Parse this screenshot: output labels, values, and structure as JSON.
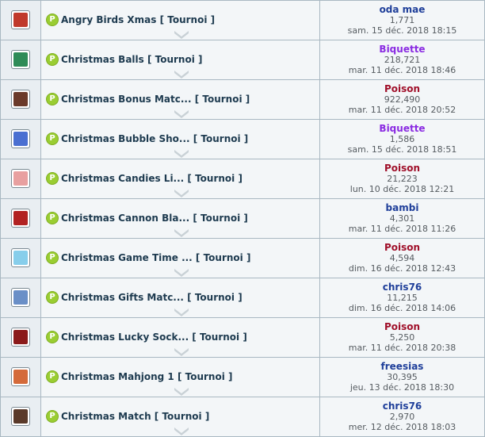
{
  "rows": [
    {
      "title": "Angry Birds Xmas [ Tournoi ]",
      "user": "oda mae",
      "user_color": "#1f3f9a",
      "score": "1,771",
      "date": "sam. 15 déc. 2018 18:15",
      "icon": "angry-birds-thumb-icon",
      "thumb_color": "#c0392b"
    },
    {
      "title": "Christmas Balls [ Tournoi ]",
      "user": "Biquette",
      "user_color": "#8a2be2",
      "score": "218,721",
      "date": "mar. 11 déc. 2018 18:46",
      "icon": "christmas-balls-thumb-icon",
      "thumb_color": "#2e8b57"
    },
    {
      "title": "Christmas Bonus Matc... [ Tournoi ]",
      "user": "Poison",
      "user_color": "#a0102a",
      "score": "922,490",
      "date": "mar. 11 déc. 2018 20:52",
      "icon": "bonus-match-thumb-icon",
      "thumb_color": "#6b3a2a"
    },
    {
      "title": "Christmas Bubble Sho... [ Tournoi ]",
      "user": "Biquette",
      "user_color": "#8a2be2",
      "score": "1,586",
      "date": "sam. 15 déc. 2018 18:51",
      "icon": "bubble-shooter-thumb-icon",
      "thumb_color": "#4a6fd1"
    },
    {
      "title": "Christmas Candies Li... [ Tournoi ]",
      "user": "Poison",
      "user_color": "#a0102a",
      "score": "21,223",
      "date": "lun. 10 déc. 2018 12:21",
      "icon": "candies-thumb-icon",
      "thumb_color": "#e8a0a0"
    },
    {
      "title": "Christmas Cannon Bla... [ Tournoi ]",
      "user": "bambi",
      "user_color": "#1f3f9a",
      "score": "4,301",
      "date": "mar. 11 déc. 2018 11:26",
      "icon": "cannon-thumb-icon",
      "thumb_color": "#b22222"
    },
    {
      "title": "Christmas Game Time ... [ Tournoi ]",
      "user": "Poison",
      "user_color": "#a0102a",
      "score": "4,594",
      "date": "dim. 16 déc. 2018 12:43",
      "icon": "game-time-thumb-icon",
      "thumb_color": "#87ceeb"
    },
    {
      "title": "Christmas Gifts Matc... [ Tournoi ]",
      "user": "chris76",
      "user_color": "#1f3f9a",
      "score": "11,215",
      "date": "dim. 16 déc. 2018 14:06",
      "icon": "gifts-match-thumb-icon",
      "thumb_color": "#6a8fc7"
    },
    {
      "title": "Christmas Lucky Sock... [ Tournoi ]",
      "user": "Poison",
      "user_color": "#a0102a",
      "score": "5,250",
      "date": "mar. 11 déc. 2018 20:38",
      "icon": "lucky-socks-thumb-icon",
      "thumb_color": "#8b1a1a"
    },
    {
      "title": "Christmas Mahjong 1 [ Tournoi ]",
      "user": "freesias",
      "user_color": "#1f3f9a",
      "score": "30,395",
      "date": "jeu. 13 déc. 2018 18:30",
      "icon": "mahjong-thumb-icon",
      "thumb_color": "#d46a3a"
    },
    {
      "title": "Christmas Match [ Tournoi ]",
      "user": "chris76",
      "user_color": "#1f3f9a",
      "score": "2,970",
      "date": "mer. 12 déc. 2018 18:03",
      "icon": "christmas-match-thumb-icon",
      "thumb_color": "#5a3a2a"
    }
  ],
  "badge_letter": "P"
}
